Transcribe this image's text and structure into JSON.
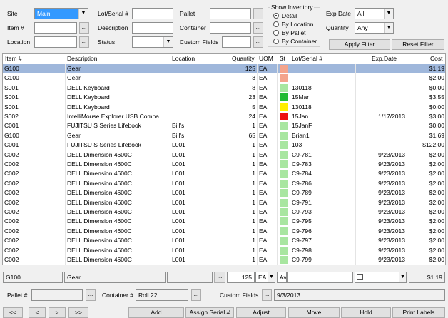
{
  "filters": {
    "site_label": "Site",
    "site_value": "Main",
    "item_label": "Item #",
    "item_value": "",
    "location_label": "Location",
    "location_value": "",
    "lot_label": "Lot/Serial #",
    "lot_value": "",
    "description_label": "Description",
    "description_value": "",
    "status_label": "Status",
    "status_value": "",
    "pallet_label": "Pallet",
    "pallet_value": "",
    "container_label": "Container",
    "container_value": "",
    "custom_fields_label": "Custom Fields",
    "custom_fields_value": "",
    "show_inventory": {
      "title": "Show Inventory",
      "options": [
        "Detail",
        "By Location",
        "By Pallet",
        "By Container"
      ],
      "selected": "Detail"
    },
    "exp_date_label": "Exp Date",
    "exp_date_value": "All",
    "quantity_label": "Quantity",
    "quantity_value": "Any",
    "apply_filter": "Apply Filter",
    "reset_filter": "Reset Filter",
    "ellipsis": "..."
  },
  "table": {
    "headers": [
      "Item #",
      "Description",
      "Location",
      "Quantity",
      "UOM",
      "St",
      "Lot/Serial #",
      "Exp.Date",
      "Cost"
    ],
    "rows": [
      {
        "item": "G100",
        "desc": "Gear",
        "loc": "",
        "qty": "125",
        "uom": "EA",
        "st": "#f4a48c",
        "lot": "",
        "exp": "",
        "cost": "$1.19",
        "selected": true
      },
      {
        "item": "G100",
        "desc": "Gear",
        "loc": "",
        "qty": "3",
        "uom": "EA",
        "st": "#f4a48c",
        "lot": "",
        "exp": "",
        "cost": "$2.00"
      },
      {
        "item": "S001",
        "desc": "DELL Keyboard",
        "loc": "",
        "qty": "8",
        "uom": "EA",
        "st": "#a8e6a0",
        "lot": "130118",
        "exp": "",
        "cost": "$0.00"
      },
      {
        "item": "S001",
        "desc": "DELL Keyboard",
        "loc": "",
        "qty": "23",
        "uom": "EA",
        "st": "#22bb33",
        "lot": "15Mar",
        "exp": "",
        "cost": "$3.55"
      },
      {
        "item": "S001",
        "desc": "DELL Keyboard",
        "loc": "",
        "qty": "5",
        "uom": "EA",
        "st": "#ffee00",
        "lot": "130118",
        "exp": "",
        "cost": "$0.00"
      },
      {
        "item": "S002",
        "desc": "IntelliMouse Explorer  USB Compa...",
        "loc": "",
        "qty": "24",
        "uom": "EA",
        "st": "#ee1111",
        "lot": "15Jan",
        "exp": "1/17/2013",
        "cost": "$3.00"
      },
      {
        "item": "C001",
        "desc": "FUJITSU S Series Lifebook",
        "loc": "Bill's",
        "qty": "1",
        "uom": "EA",
        "st": "#a8e6a0",
        "lot": "15JanF",
        "exp": "",
        "cost": "$0.00"
      },
      {
        "item": "G100",
        "desc": "Gear",
        "loc": "Bill's",
        "qty": "65",
        "uom": "EA",
        "st": "#a8e6a0",
        "lot": "Brian1",
        "exp": "",
        "cost": "$1.69"
      },
      {
        "item": "C001",
        "desc": "FUJITSU S Series Lifebook",
        "loc": "L001",
        "qty": "1",
        "uom": "EA",
        "st": "#a8e6a0",
        "lot": "103",
        "exp": "",
        "cost": "$122.00"
      },
      {
        "item": "C002",
        "desc": "DELL Dimension 4600C",
        "loc": "L001",
        "qty": "1",
        "uom": "EA",
        "st": "#a8e6a0",
        "lot": "C9-781",
        "exp": "9/23/2013",
        "cost": "$2.00"
      },
      {
        "item": "C002",
        "desc": "DELL Dimension 4600C",
        "loc": "L001",
        "qty": "1",
        "uom": "EA",
        "st": "#a8e6a0",
        "lot": "C9-783",
        "exp": "9/23/2013",
        "cost": "$2.00"
      },
      {
        "item": "C002",
        "desc": "DELL Dimension 4600C",
        "loc": "L001",
        "qty": "1",
        "uom": "EA",
        "st": "#a8e6a0",
        "lot": "C9-784",
        "exp": "9/23/2013",
        "cost": "$2.00"
      },
      {
        "item": "C002",
        "desc": "DELL Dimension 4600C",
        "loc": "L001",
        "qty": "1",
        "uom": "EA",
        "st": "#a8e6a0",
        "lot": "C9-786",
        "exp": "9/23/2013",
        "cost": "$2.00"
      },
      {
        "item": "C002",
        "desc": "DELL Dimension 4600C",
        "loc": "L001",
        "qty": "1",
        "uom": "EA",
        "st": "#a8e6a0",
        "lot": "C9-789",
        "exp": "9/23/2013",
        "cost": "$2.00"
      },
      {
        "item": "C002",
        "desc": "DELL Dimension 4600C",
        "loc": "L001",
        "qty": "1",
        "uom": "EA",
        "st": "#a8e6a0",
        "lot": "C9-791",
        "exp": "9/23/2013",
        "cost": "$2.00"
      },
      {
        "item": "C002",
        "desc": "DELL Dimension 4600C",
        "loc": "L001",
        "qty": "1",
        "uom": "EA",
        "st": "#a8e6a0",
        "lot": "C9-793",
        "exp": "9/23/2013",
        "cost": "$2.00"
      },
      {
        "item": "C002",
        "desc": "DELL Dimension 4600C",
        "loc": "L001",
        "qty": "1",
        "uom": "EA",
        "st": "#a8e6a0",
        "lot": "C9-795",
        "exp": "9/23/2013",
        "cost": "$2.00"
      },
      {
        "item": "C002",
        "desc": "DELL Dimension 4600C",
        "loc": "L001",
        "qty": "1",
        "uom": "EA",
        "st": "#a8e6a0",
        "lot": "C9-796",
        "exp": "9/23/2013",
        "cost": "$2.00"
      },
      {
        "item": "C002",
        "desc": "DELL Dimension 4600C",
        "loc": "L001",
        "qty": "1",
        "uom": "EA",
        "st": "#a8e6a0",
        "lot": "C9-797",
        "exp": "9/23/2013",
        "cost": "$2.00"
      },
      {
        "item": "C002",
        "desc": "DELL Dimension 4600C",
        "loc": "L001",
        "qty": "1",
        "uom": "EA",
        "st": "#a8e6a0",
        "lot": "C9-798",
        "exp": "9/23/2013",
        "cost": "$2.00"
      },
      {
        "item": "C002",
        "desc": "DELL Dimension 4600C",
        "loc": "L001",
        "qty": "1",
        "uom": "EA",
        "st": "#a8e6a0",
        "lot": "C9-799",
        "exp": "9/23/2013",
        "cost": "$2.00"
      }
    ]
  },
  "edit_row": {
    "item": "G100",
    "desc": "Gear",
    "loc": "",
    "qty": "125",
    "uom": "EA",
    "st": "Av",
    "lot": "",
    "exp": "",
    "cost": "$1.19"
  },
  "detail": {
    "pallet_label": "Pallet #",
    "pallet_value": "",
    "container_label": "Container #",
    "container_value": "Roll 22",
    "custom_fields_label": "Custom Fields",
    "custom_fields_value": "9/3/2013"
  },
  "nav": {
    "first": "<<",
    "prev": "<",
    "next": ">",
    "last": ">>"
  },
  "actions": {
    "add": "Add",
    "assign_serial": "Assign Serial #",
    "adjust": "Adjust",
    "move": "Move",
    "hold": "Hold",
    "print_labels": "Print Labels"
  },
  "icons": {
    "dropdown": "chevron-down-icon",
    "radio": "radio-icon"
  }
}
